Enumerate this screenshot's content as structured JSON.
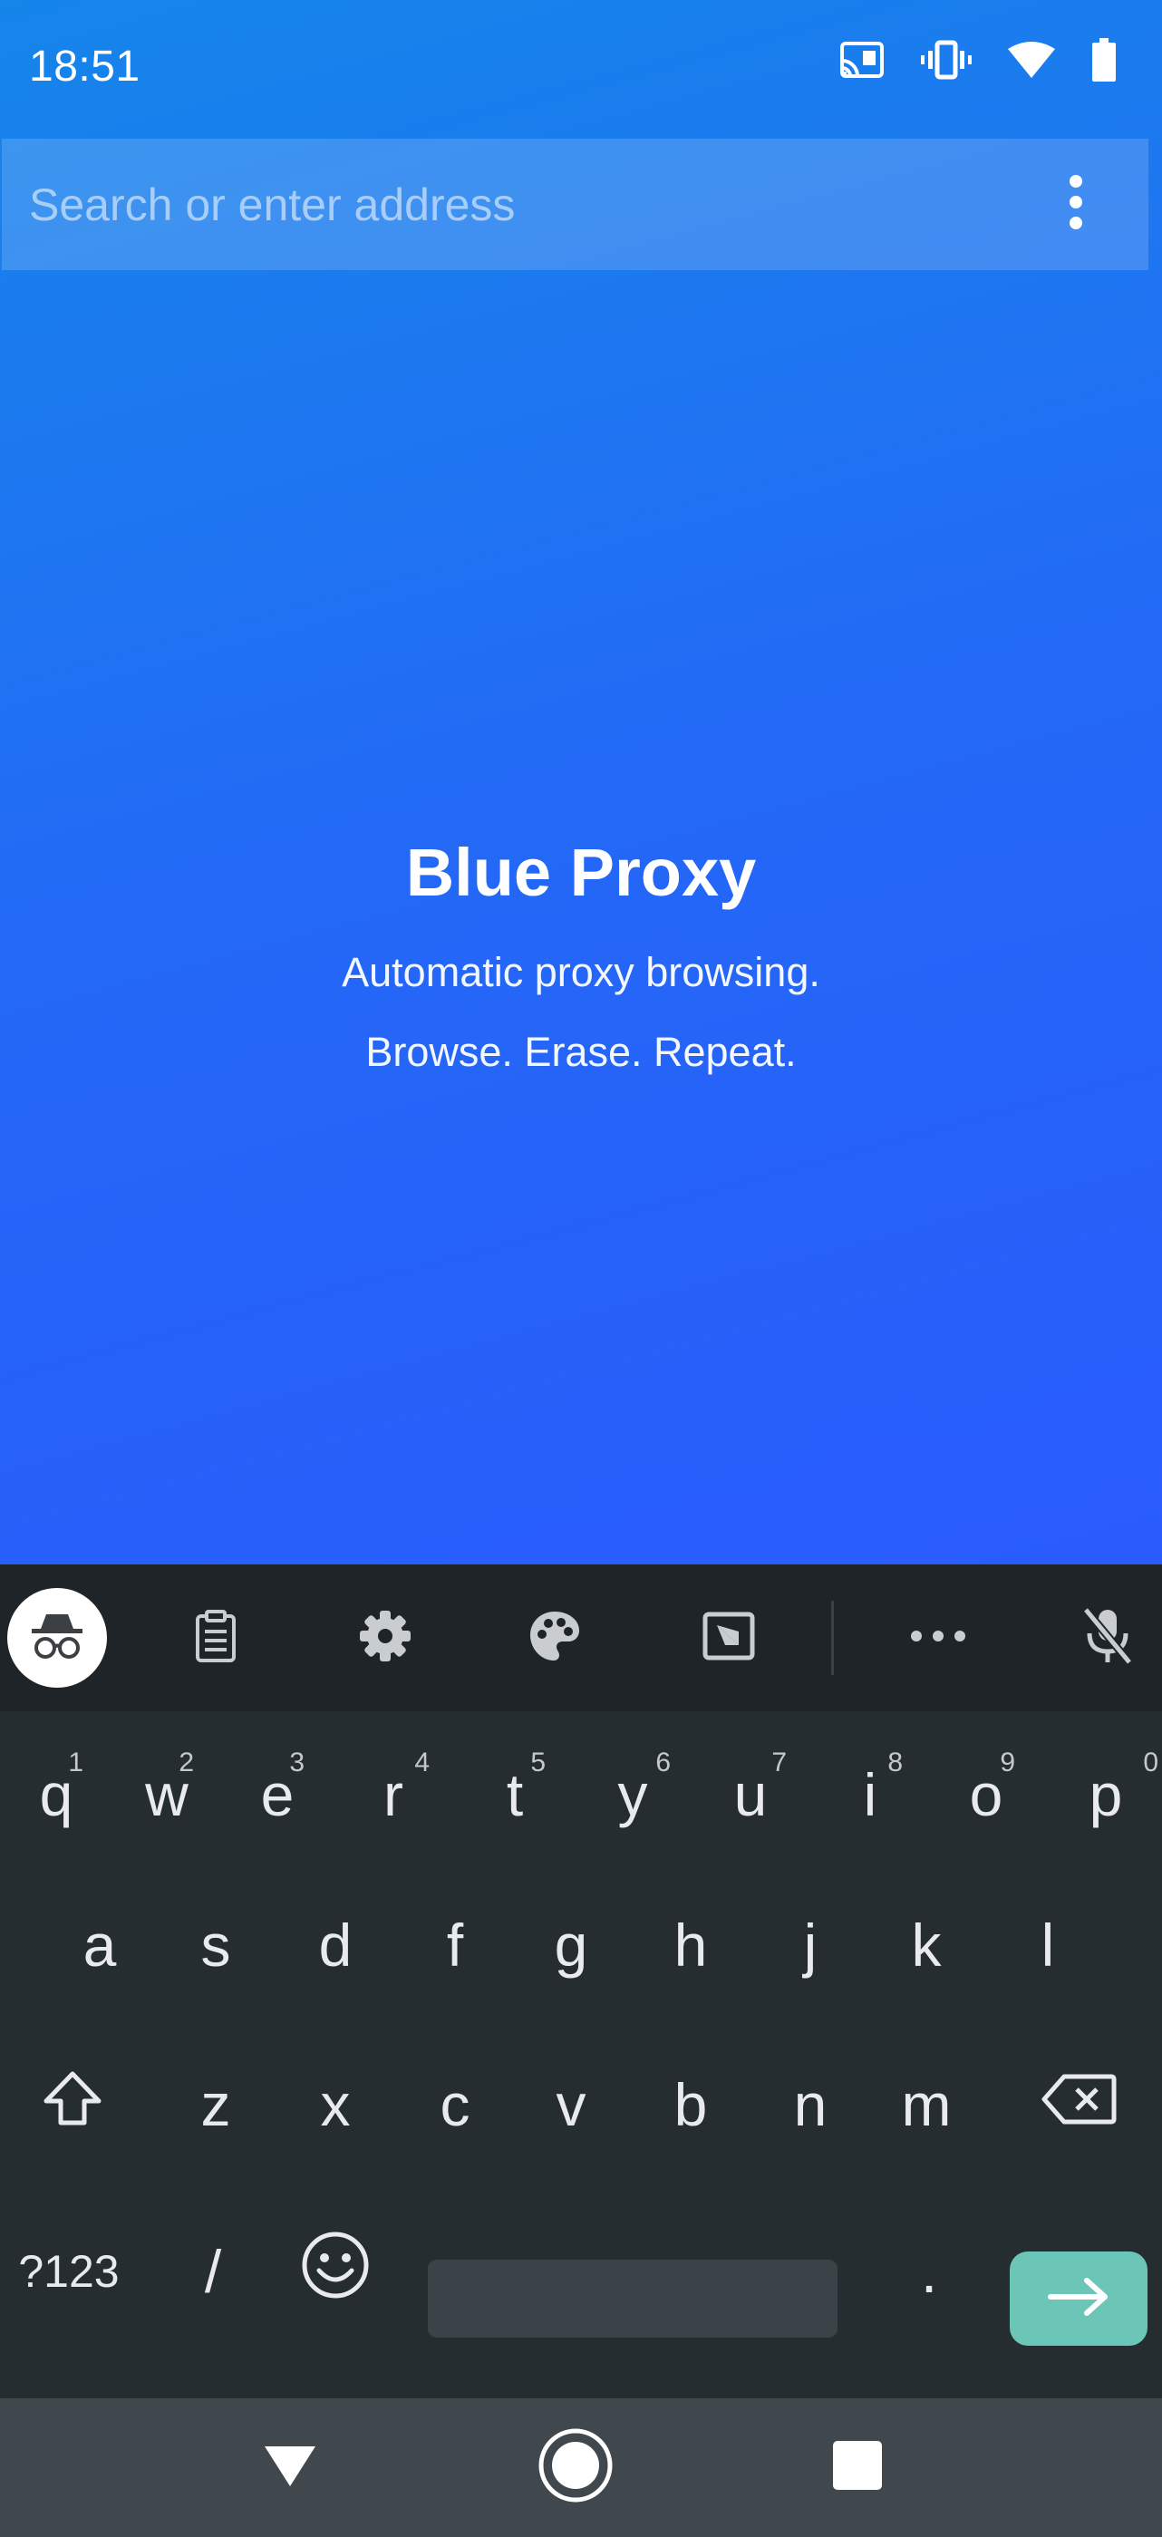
{
  "status_bar": {
    "time": "18:51",
    "icons": [
      "cast-icon",
      "vibrate-icon",
      "wifi-icon",
      "battery-icon"
    ]
  },
  "address_bar": {
    "placeholder": "Search or enter address",
    "value": ""
  },
  "hero": {
    "title": "Blue Proxy",
    "line1": "Automatic proxy browsing.",
    "line2": "Browse. Erase. Repeat."
  },
  "keyboard_toolbar": {
    "items": [
      "incognito-icon",
      "clipboard-icon",
      "settings-icon",
      "palette-icon",
      "screenshot-icon",
      "more-icon",
      "mic-off-icon"
    ]
  },
  "keyboard": {
    "row1": [
      {
        "key": "q",
        "hint": "1"
      },
      {
        "key": "w",
        "hint": "2"
      },
      {
        "key": "e",
        "hint": "3"
      },
      {
        "key": "r",
        "hint": "4"
      },
      {
        "key": "t",
        "hint": "5"
      },
      {
        "key": "y",
        "hint": "6"
      },
      {
        "key": "u",
        "hint": "7"
      },
      {
        "key": "i",
        "hint": "8"
      },
      {
        "key": "o",
        "hint": "9"
      },
      {
        "key": "p",
        "hint": "0"
      }
    ],
    "row2": [
      "a",
      "s",
      "d",
      "f",
      "g",
      "h",
      "j",
      "k",
      "l"
    ],
    "row3": [
      "z",
      "x",
      "c",
      "v",
      "b",
      "n",
      "m"
    ],
    "symbols_label": "?123",
    "slash_label": "/",
    "period_label": "."
  },
  "colors": {
    "gradient_top": "#1585ea",
    "gradient_bottom": "#2a5cfd",
    "enter_key": "#6cc6b8",
    "keyboard_bg": "#262d31"
  }
}
